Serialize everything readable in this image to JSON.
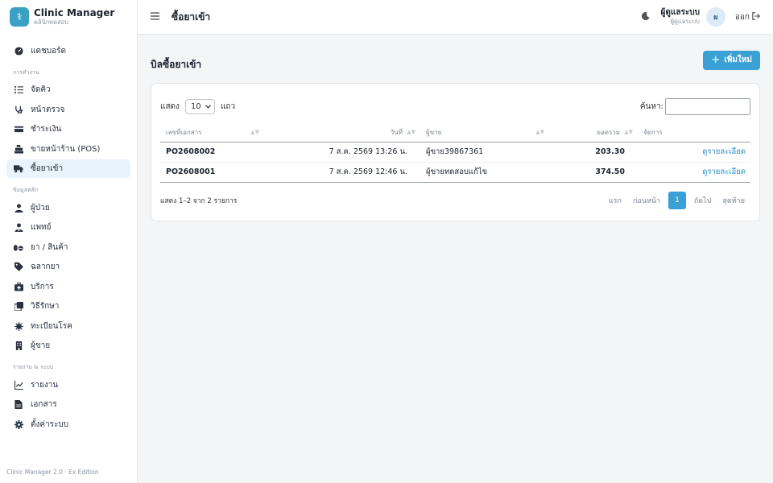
{
  "brand": {
    "logo_glyph": "⚕",
    "name": "Clinic Manager",
    "subtitle": "คลินิกทดสอบ"
  },
  "sidebar": {
    "top_items": [
      {
        "label": "แดชบอร์ด",
        "icon": "dashboard-icon"
      }
    ],
    "section_ops": "การทำงาน",
    "ops_items": [
      {
        "label": "จัดคิว",
        "icon": "queue-list-icon"
      },
      {
        "label": "หน้าตรวจ",
        "icon": "stethoscope-icon"
      },
      {
        "label": "ชำระเงิน",
        "icon": "credit-card-icon"
      },
      {
        "label": "ขายหน้าร้าน (POS)",
        "icon": "cash-register-icon"
      },
      {
        "label": "ซื้อยาเข้า",
        "icon": "truck-icon",
        "active": true
      }
    ],
    "section_master": "ข้อมูลหลัก",
    "master_items": [
      {
        "label": "ผู้ป่วย",
        "icon": "user-icon"
      },
      {
        "label": "แพทย์",
        "icon": "doctor-icon"
      },
      {
        "label": "ยา / สินค้า",
        "icon": "pills-icon"
      },
      {
        "label": "ฉลากยา",
        "icon": "tag-icon"
      },
      {
        "label": "บริการ",
        "icon": "medkit-icon"
      },
      {
        "label": "วิธีรักษา",
        "icon": "layers-icon"
      },
      {
        "label": "ทะเบียนโรค",
        "icon": "virus-icon"
      },
      {
        "label": "ผู้ขาย",
        "icon": "building-icon"
      }
    ],
    "section_reports": "รายงาน & ระบบ",
    "report_items": [
      {
        "label": "รายงาน",
        "icon": "chart-icon"
      },
      {
        "label": "เอกสาร",
        "icon": "document-icon"
      },
      {
        "label": "ตั้งค่าระบบ",
        "icon": "gear-icon"
      }
    ],
    "footer": "Clinic Manager 2.0 · Ex Edition"
  },
  "topbar": {
    "title": "ซื้อยาเข้า",
    "user_name": "ผู้ดูแลระบบ",
    "user_role": "ผู้ดูแลระบบ",
    "avatar_initial": "ผ",
    "logout_label": "ออก"
  },
  "page": {
    "title": "บิลซื้อยาเข้า",
    "add_button": "เพิ่มใหม่"
  },
  "table": {
    "length_label_before": "แสดง",
    "length_value": "10",
    "length_label_after": "แถว",
    "search_label": "ค้นหา:",
    "search_value": "",
    "headers": {
      "doc_no": "เลขที่เอกสาร",
      "date": "วันที่",
      "vendor": "ผู้ขาย",
      "total": "ยอดรวม",
      "actions": "จัดการ"
    },
    "rows": [
      {
        "doc_no": "PO2608002",
        "date": "7 ส.ค. 2569 13:26 น.",
        "vendor": "ผู้ขาย39867361",
        "total": "203.30",
        "action": "ดูรายละเอียด"
      },
      {
        "doc_no": "PO2608001",
        "date": "7 ส.ค. 2569 12:46 น.",
        "vendor": "ผู้ขายทดสอบแก้ไข",
        "total": "374.50",
        "action": "ดูรายละเอียด"
      }
    ],
    "info": "แสดง 1–2 จาก 2 รายการ",
    "pager": {
      "first": "แรก",
      "prev": "ก่อนหน้า",
      "current": "1",
      "next": "ถัดไป",
      "last": "สุดท้าย"
    }
  },
  "colors": {
    "accent": "#3aa0d6",
    "active_bg": "#e9f3fb",
    "link": "#2a8fc6"
  }
}
